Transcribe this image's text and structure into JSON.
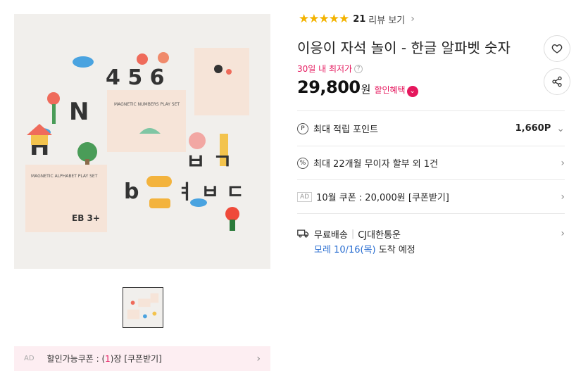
{
  "rating": {
    "stars": "★★★★★",
    "count": "21",
    "review_link": "리뷰 보기"
  },
  "product": {
    "title": "이응이 자석 놀이 - 한글 알파벳 숫자",
    "lowest_label": "30일 내 최저가",
    "price": "29,800",
    "price_unit": "원",
    "discount_label": "할인혜택"
  },
  "rows": {
    "points": {
      "label": "최대 적립 포인트",
      "value": "1,660P"
    },
    "installment": {
      "label": "최대 22개월 무이자 할부 외 1건"
    },
    "coupon": {
      "ad": "AD",
      "label": "10월 쿠폰 : 20,000원 [쿠폰받기]"
    },
    "shipping": {
      "label": "무료배송",
      "carrier": "CJ대한통운",
      "date_prefix": "모레 10/16(목)",
      "date_suffix": "도착 예정"
    }
  },
  "coupon_bar": {
    "ad": "AD",
    "label_a": "할인가능쿠폰 : (",
    "qty": "1",
    "label_b": ")장 [쿠폰받기]"
  },
  "colors": {
    "accent": "#e5175d",
    "star": "#f3b300",
    "link_blue": "#2a6ed1"
  }
}
